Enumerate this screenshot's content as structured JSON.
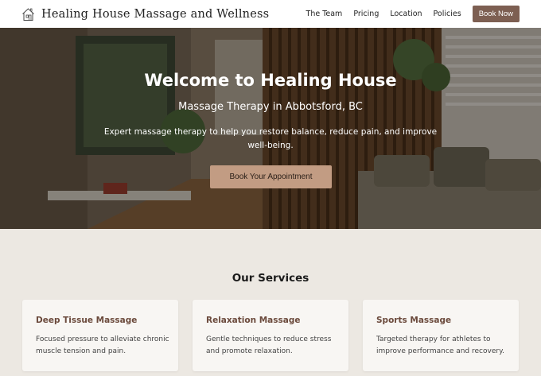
{
  "brand": {
    "name": "Healing House Massage and Wellness",
    "icon": "house-icon"
  },
  "nav": {
    "links": [
      "The Team",
      "Pricing",
      "Location",
      "Policies"
    ],
    "cta": "Book Now"
  },
  "hero": {
    "title": "Welcome to Healing House",
    "subtitle": "Massage Therapy in Abbotsford, BC",
    "description": "Expert massage therapy to help you restore balance, reduce pain, and improve well-being.",
    "button": "Book Your Appointment"
  },
  "services": {
    "title": "Our Services",
    "cards": [
      {
        "title": "Deep Tissue Massage",
        "description": "Focused pressure to alleviate chronic muscle tension and pain."
      },
      {
        "title": "Relaxation Massage",
        "description": "Gentle techniques to reduce stress and promote relaxation."
      },
      {
        "title": "Sports Massage",
        "description": "Targeted therapy for athletes to improve performance and recovery."
      }
    ]
  },
  "colors": {
    "accent": "#7d5f52",
    "hero_button": "#c29c83",
    "card_title": "#6b4a3c",
    "page_bg": "#ece8e2"
  }
}
